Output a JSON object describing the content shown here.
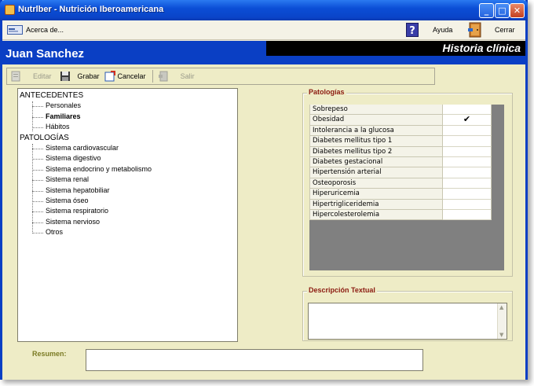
{
  "window": {
    "title": "Nutrlber - Nutrición Iberoamericana",
    "controls": {
      "minimize": "_",
      "maximize": "□",
      "close": "✕"
    }
  },
  "menubar": {
    "about_label": "Acerca de...",
    "help_label": "Ayuda",
    "close_label": "Cerrar"
  },
  "header": {
    "user_name": "Juan Sanchez",
    "section_title": "Historia clínica"
  },
  "toolbar": {
    "items": [
      {
        "label": "Editar",
        "icon": "edit-icon",
        "enabled": false
      },
      {
        "label": "Grabar",
        "icon": "save-icon",
        "enabled": true
      },
      {
        "label": "Cancelar",
        "icon": "cancel-icon",
        "enabled": true
      },
      {
        "label": "Salir",
        "icon": "exit-icon",
        "enabled": false
      }
    ]
  },
  "tree": {
    "antecedentes": {
      "label": "ANTECEDENTES",
      "children": [
        "Personales",
        "Familiares",
        "Hábitos"
      ],
      "selected": "Familiares"
    },
    "patologias": {
      "label": "PATOLOGÍAS",
      "children": [
        "Sistema cardiovascular",
        "Sistema digestivo",
        "Sistema endocrino y metabolismo",
        "Sistema renal",
        "Sistema hepatobiliar",
        "Sistema óseo",
        "Sistema respiratorio",
        "Sistema nervioso",
        "Otros"
      ]
    }
  },
  "patologias_panel": {
    "title": "Patologías",
    "rows": [
      {
        "label": "Sobrepeso",
        "checked": false,
        "mark": ""
      },
      {
        "label": "Obesidad",
        "checked": true,
        "mark": "✔"
      },
      {
        "label": "Intolerancia a la glucosa",
        "checked": false,
        "mark": ""
      },
      {
        "label": "Diabetes mellitus tipo 1",
        "checked": false,
        "mark": ""
      },
      {
        "label": "Diabetes mellitus tipo 2",
        "checked": false,
        "mark": ""
      },
      {
        "label": "Diabetes gestacional",
        "checked": false,
        "mark": ""
      },
      {
        "label": "Hipertensión arterial",
        "checked": false,
        "mark": ""
      },
      {
        "label": "Osteoporosis",
        "checked": false,
        "mark": ""
      },
      {
        "label": "Hiperuricemia",
        "checked": false,
        "mark": ""
      },
      {
        "label": "Hipertrigliceridemia",
        "checked": false,
        "mark": ""
      },
      {
        "label": "Hipercolesterolemia",
        "checked": false,
        "mark": ""
      }
    ]
  },
  "descripcion": {
    "title": "Descripción Textual",
    "value": ""
  },
  "resumen": {
    "label": "Resumen:",
    "value": ""
  },
  "colors": {
    "header_blue": "#0a3fc4",
    "panel_bg": "#eeecc6",
    "group_label": "#8b1a10",
    "resumen_label": "#7b7b24"
  }
}
